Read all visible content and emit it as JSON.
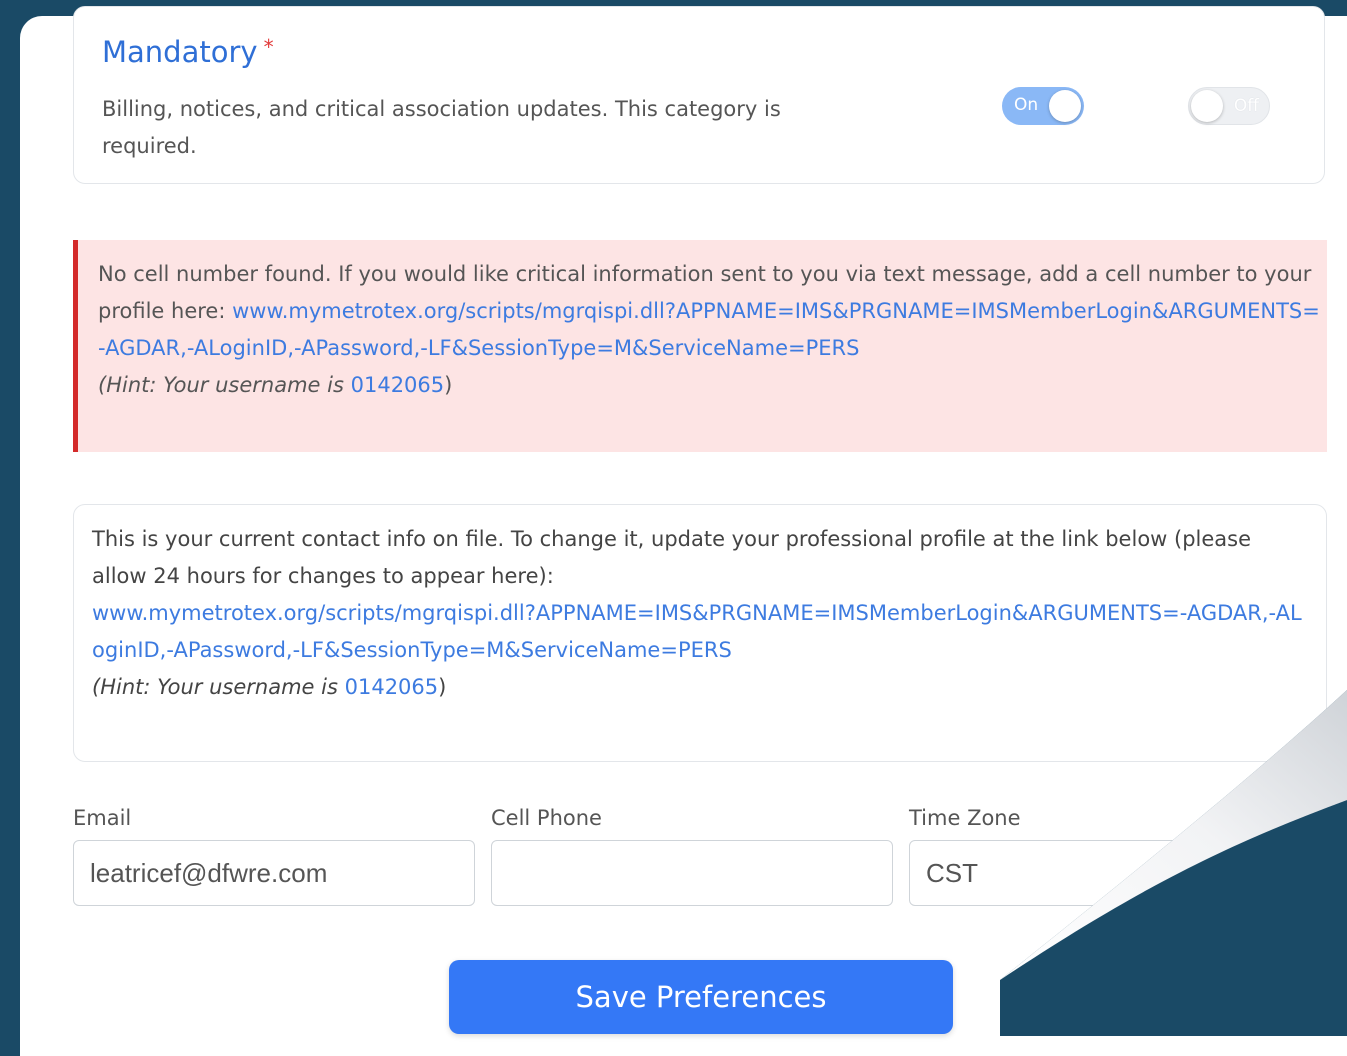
{
  "mandatory": {
    "title": "Mandatory",
    "required_mark": "*",
    "description": "Billing, notices, and critical association updates. This category is required.",
    "toggle_on_label": "On",
    "toggle_off_label": "Off"
  },
  "alert": {
    "text": "No cell number found. If you would like critical information sent to you via text message, add a cell number to your profile here:",
    "link": "www.mymetrotex.org/scripts/mgrqispi.dll?APPNAME=IMS&PRGNAME=IMSMemberLogin&ARGUMENTS=-AGDAR,-ALoginID,-APassword,-LF&SessionType=M&ServiceName=PERS",
    "hint_prefix": "(Hint: Your username is",
    "username": "0142065",
    "hint_suffix": ")"
  },
  "contact_info": {
    "text": "This is your current contact info on file. To change it, update your professional profile at the link below (please allow 24 hours for changes to appear here):",
    "link": "www.mymetrotex.org/scripts/mgrqispi.dll?APPNAME=IMS&PRGNAME=IMSMemberLogin&ARGUMENTS=-AGDAR,-ALoginID,-APassword,-LF&SessionType=M&ServiceName=PERS",
    "hint_prefix": "(Hint: Your username is",
    "username": "0142065",
    "hint_suffix": ")"
  },
  "form": {
    "email_label": "Email",
    "email_value": "leatricef@dfwre.com",
    "cell_label": "Cell Phone",
    "cell_value": "",
    "timezone_label": "Time Zone",
    "timezone_value": "CST"
  },
  "save_label": "Save Preferences",
  "colors": {
    "accent": "#3478f6",
    "frame": "#1a4a66",
    "alert_bg": "#fde4e4",
    "alert_border": "#d42a2a",
    "link": "#3d7be0"
  }
}
